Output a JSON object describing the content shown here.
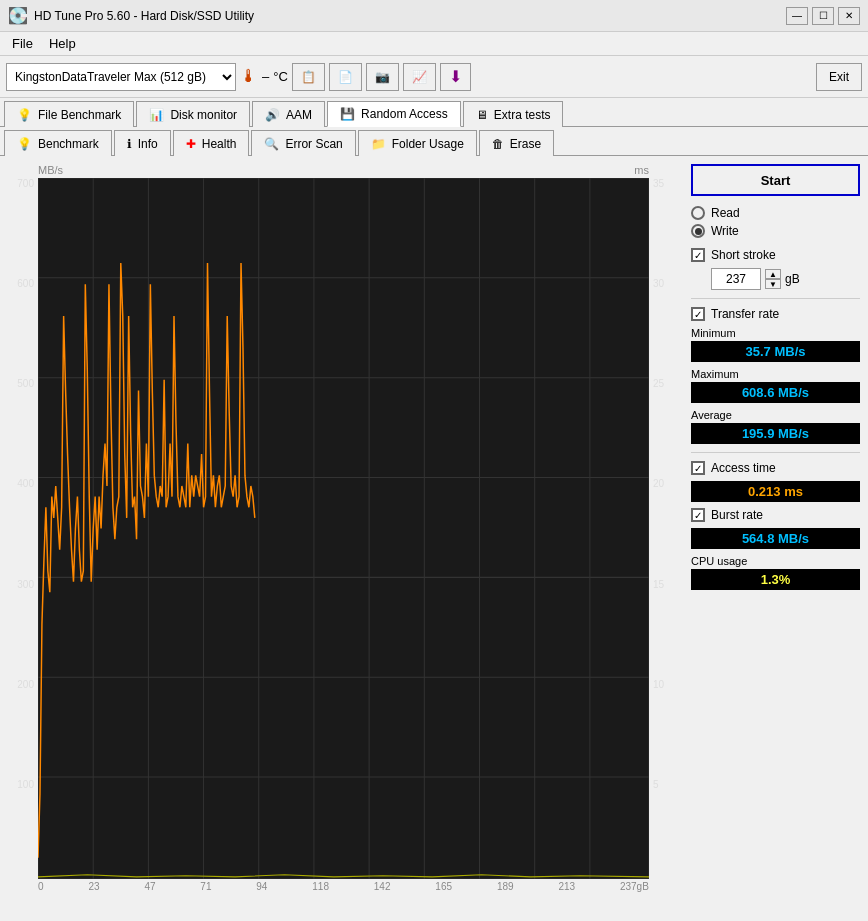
{
  "window": {
    "title": "HD Tune Pro 5.60 - Hard Disk/SSD Utility",
    "controls": [
      "minimize",
      "restore",
      "close"
    ]
  },
  "menu": {
    "items": [
      "File",
      "Help"
    ]
  },
  "toolbar": {
    "disk": "KingstonDataTraveler Max (512 gB)",
    "temp_dash": "–",
    "temp_unit": "°C",
    "exit_label": "Exit"
  },
  "tabs_row1": [
    {
      "label": "File Benchmark",
      "icon": "💡",
      "active": false
    },
    {
      "label": "Disk monitor",
      "icon": "📊",
      "active": false
    },
    {
      "label": "AAM",
      "icon": "🔊",
      "active": false
    },
    {
      "label": "Random Access",
      "icon": "💾",
      "active": true
    },
    {
      "label": "Extra tests",
      "icon": "🖥",
      "active": false
    }
  ],
  "tabs_row2": [
    {
      "label": "Benchmark",
      "icon": "💡",
      "active": false
    },
    {
      "label": "Info",
      "icon": "ℹ",
      "active": false
    },
    {
      "label": "Health",
      "icon": "➕",
      "active": false
    },
    {
      "label": "Error Scan",
      "icon": "🔍",
      "active": false
    },
    {
      "label": "Folder Usage",
      "icon": "📁",
      "active": false
    },
    {
      "label": "Erase",
      "icon": "🗑",
      "active": false
    }
  ],
  "chart": {
    "y_axis_left_label": "MB/s",
    "y_axis_right_label": "ms",
    "y_left_ticks": [
      "700",
      "600",
      "500",
      "400",
      "300",
      "200",
      "100",
      ""
    ],
    "y_right_ticks": [
      "35",
      "30",
      "25",
      "20",
      "15",
      "10",
      "5",
      ""
    ],
    "x_ticks": [
      "0",
      "23",
      "47",
      "71",
      "94",
      "118",
      "142",
      "165",
      "189",
      "213",
      "237gB"
    ]
  },
  "controls": {
    "start_label": "Start",
    "read_label": "Read",
    "write_label": "Write",
    "write_selected": true,
    "short_stroke_label": "Short stroke",
    "short_stroke_checked": true,
    "stroke_value": "237",
    "stroke_unit": "gB",
    "transfer_rate_label": "Transfer rate",
    "transfer_rate_checked": true,
    "minimum_label": "Minimum",
    "minimum_value": "35.7 MB/s",
    "maximum_label": "Maximum",
    "maximum_value": "608.6 MB/s",
    "average_label": "Average",
    "average_value": "195.9 MB/s",
    "access_time_label": "Access time",
    "access_time_checked": true,
    "access_time_value": "0.213 ms",
    "burst_rate_label": "Burst rate",
    "burst_rate_checked": true,
    "burst_rate_value": "564.8 MB/s",
    "cpu_usage_label": "CPU usage",
    "cpu_usage_value": "1.3%"
  }
}
